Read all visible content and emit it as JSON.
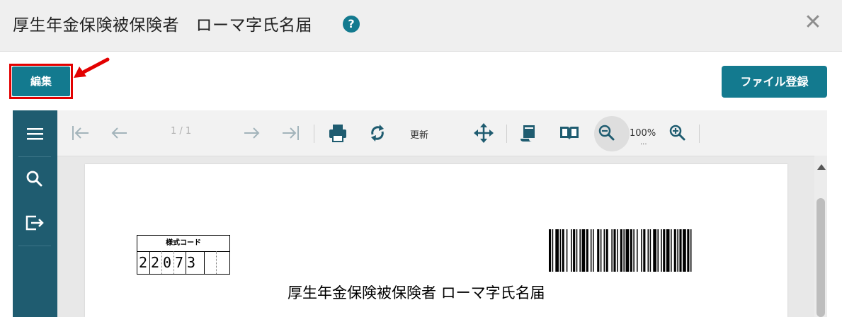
{
  "dialog": {
    "title": "厚生年金保険被保険者　ローマ字氏名届",
    "help_glyph": "?",
    "close_glyph": "✕"
  },
  "actions": {
    "edit_label": "編集",
    "file_register_label": "ファイル登録"
  },
  "colors": {
    "accent": "#137a8f",
    "sidebar": "#1f5c70",
    "highlight": "#e30000"
  },
  "viewer": {
    "sidebar_icons": [
      "menu-icon",
      "search-icon",
      "export-icon"
    ],
    "toolbar": {
      "page_indicator": "1 / 1",
      "refresh_label": "更新",
      "zoom_level": "100%",
      "zoom_more": "..."
    },
    "document": {
      "code_label": "様式コード",
      "code_digits": [
        "2",
        "2",
        "0",
        "7",
        "3",
        "",
        ""
      ],
      "title": "厚生年金保険被保険者 ローマ字氏名届"
    }
  }
}
